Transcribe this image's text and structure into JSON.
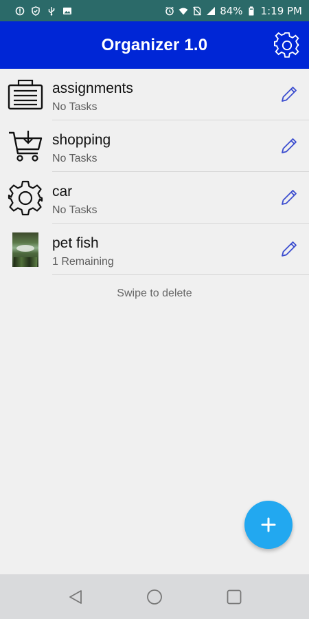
{
  "status_bar": {
    "battery": "84%",
    "time": "1:19 PM",
    "left_icons": [
      "alert-icon",
      "shield-icon",
      "usb-icon",
      "image-icon"
    ],
    "right_icons": [
      "alarm-icon",
      "wifi-icon",
      "no-sim-icon",
      "signal-icon",
      "battery-icon"
    ]
  },
  "app_bar": {
    "title": "Organizer 1.0",
    "color": "#0026d6",
    "settings_icon": "gear-icon"
  },
  "lists": [
    {
      "title": "assignments",
      "subtitle": "No Tasks",
      "icon": "briefcase-icon"
    },
    {
      "title": "shopping",
      "subtitle": "No Tasks",
      "icon": "shopping-cart-icon"
    },
    {
      "title": "car",
      "subtitle": "No Tasks",
      "icon": "gear-icon"
    },
    {
      "title": "pet fish",
      "subtitle": "1 Remaining",
      "icon": "photo-thumbnail"
    }
  ],
  "edit_icon": "pencil-icon",
  "hint": "Swipe to delete",
  "fab": {
    "icon": "plus-icon",
    "color": "#22a8f0"
  },
  "nav_bar": {
    "back": "back-icon",
    "home": "home-icon",
    "recents": "recents-icon"
  }
}
